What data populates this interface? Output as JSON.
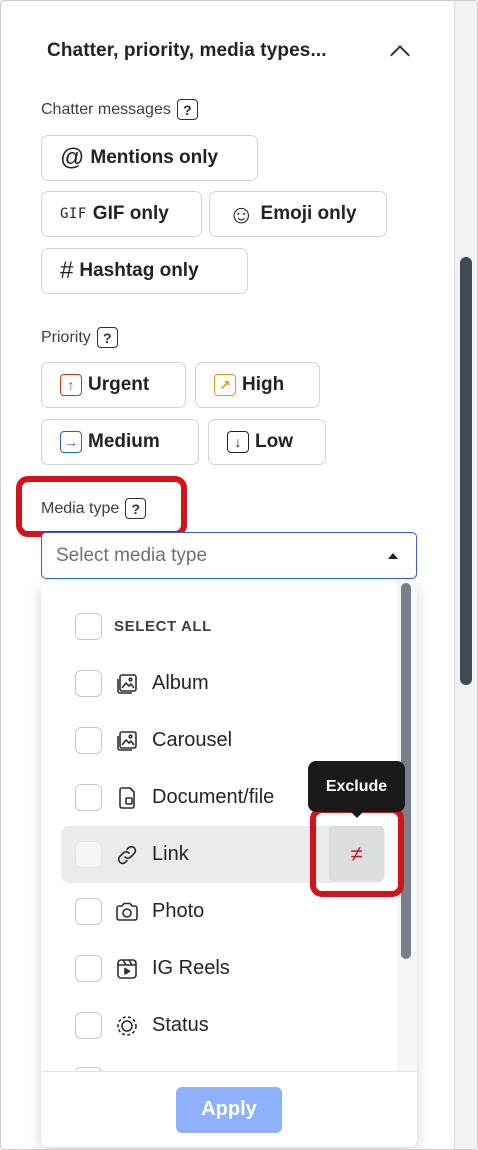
{
  "section": {
    "title": "Chatter, priority, media types..."
  },
  "chatter": {
    "label": "Chatter messages",
    "help": "?",
    "chips": [
      {
        "icon": "at-icon",
        "glyph": "@",
        "label": "Mentions only"
      },
      {
        "icon": "gif-icon",
        "glyph": "GIF",
        "label": "GIF only"
      },
      {
        "icon": "smiley-icon",
        "glyph": "☺",
        "label": "Emoji only"
      },
      {
        "icon": "hashtag-icon",
        "glyph": "#",
        "label": "Hashtag only"
      }
    ]
  },
  "priority": {
    "label": "Priority",
    "help": "?",
    "chips": [
      {
        "icon": "arrow-up-icon",
        "glyph": "↑",
        "label": "Urgent",
        "color": "#d92d20"
      },
      {
        "icon": "arrow-up-right-icon",
        "glyph": "↗",
        "label": "High",
        "color": "#d4a017"
      },
      {
        "icon": "arrow-right-icon",
        "glyph": "→",
        "label": "Medium",
        "color": "#2f5bd3"
      },
      {
        "icon": "arrow-down-icon",
        "glyph": "↓",
        "label": "Low",
        "color": "#1f2328"
      }
    ]
  },
  "media": {
    "label": "Media type",
    "help": "?",
    "placeholder": "Select media type",
    "select_all": "SELECT ALL",
    "options": [
      {
        "icon": "album-icon",
        "label": "Album"
      },
      {
        "icon": "carousel-icon",
        "label": "Carousel"
      },
      {
        "icon": "document-icon",
        "label": "Document/file"
      },
      {
        "icon": "link-icon",
        "label": "Link"
      },
      {
        "icon": "camera-icon",
        "label": "Photo"
      },
      {
        "icon": "reels-icon",
        "label": "IG Reels"
      },
      {
        "icon": "status-icon",
        "label": "Status"
      }
    ],
    "apply": "Apply",
    "exclude_tooltip": "Exclude",
    "exclude_glyph": "≠"
  },
  "colors": {
    "highlight": "#d2131b",
    "apply_button": "#8fb1fb",
    "select_border": "#3b5bdb"
  }
}
